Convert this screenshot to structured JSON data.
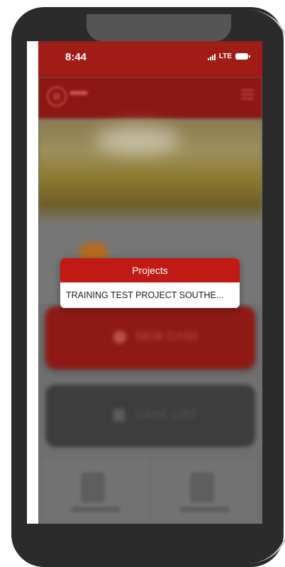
{
  "status_bar": {
    "time": "8:44",
    "network": "LTE"
  },
  "app": {
    "buttons": {
      "new_case": "NEW CASE",
      "case_list": "CASE LIST"
    }
  },
  "modal": {
    "title": "Projects",
    "items": [
      "TRAINING TEST PROJECT SOUTHE..."
    ]
  },
  "colors": {
    "brand_red": "#c11a15",
    "status_bar_red": "#a11b17",
    "phone_frame": "#2b2b2b"
  },
  "icons": {
    "signal": "signal-icon",
    "battery": "battery-icon",
    "logo": "logo-icon",
    "menu": "hamburger-menu-icon",
    "new_case": "camera-icon",
    "case_list": "clipboard-icon",
    "search_tile": "document-search-icon",
    "report_tile": "document-report-icon"
  }
}
